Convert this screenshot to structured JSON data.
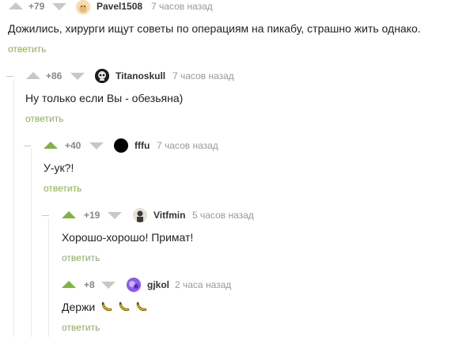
{
  "comments": [
    {
      "rating": "+79",
      "author": "Pavel1508",
      "time": "7 часов назад",
      "text": "Дожились, хирурги ищут советы по операциям на пикабу, страшно жить однако.",
      "reply": "ответить"
    },
    {
      "rating": "+86",
      "author": "Titanoskull",
      "time": "7 часов назад",
      "text": "Ну только если Вы - обезьяна)",
      "reply": "ответить"
    },
    {
      "rating": "+40",
      "author": "fffu",
      "time": "7 часов назад",
      "text": "У-ук?!",
      "reply": "ответить"
    },
    {
      "rating": "+19",
      "author": "Vitfmin",
      "time": "5 часов назад",
      "text": "Хорошо-хорошо! Примат!",
      "reply": "ответить"
    },
    {
      "rating": "+8",
      "author": "gjkol",
      "time": "2 часа назад",
      "text": "Держи",
      "emojis": [
        "banana",
        "banana",
        "banana"
      ],
      "reply": "ответить"
    }
  ],
  "colors": {
    "upvote_active": "#7fb53e",
    "reply_link": "#8ab34a",
    "inactive_arrow": "#c8c8c8"
  }
}
